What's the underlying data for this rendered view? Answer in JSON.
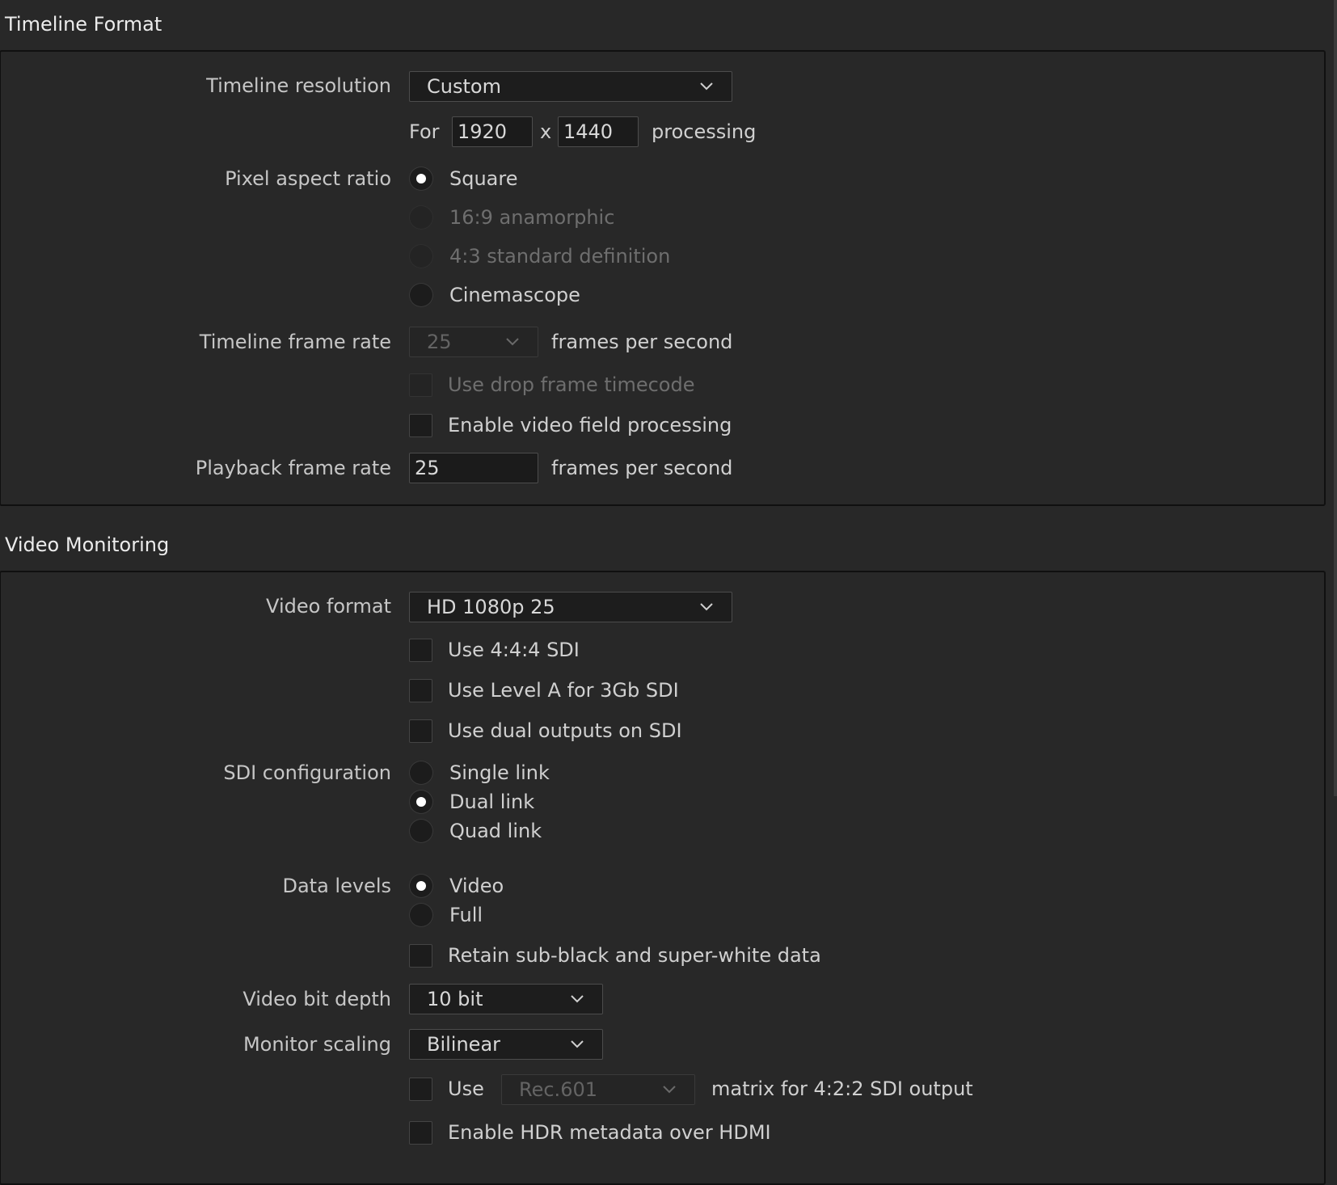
{
  "timeline_format": {
    "title": "Timeline Format",
    "timeline_resolution": {
      "label": "Timeline resolution",
      "value": "Custom"
    },
    "processing": {
      "for": "For",
      "width": "1920",
      "x": "x",
      "height": "1440",
      "suffix": "processing"
    },
    "pixel_aspect_ratio": {
      "label": "Pixel aspect ratio",
      "options": [
        {
          "label": "Square",
          "selected": true,
          "enabled": true
        },
        {
          "label": "16:9 anamorphic",
          "selected": false,
          "enabled": false
        },
        {
          "label": "4:3 standard definition",
          "selected": false,
          "enabled": false
        },
        {
          "label": "Cinemascope",
          "selected": false,
          "enabled": true
        }
      ]
    },
    "timeline_frame_rate": {
      "label": "Timeline frame rate",
      "value": "25",
      "suffix": "frames per second"
    },
    "use_drop_frame": {
      "label": "Use drop frame timecode",
      "checked": false,
      "enabled": false
    },
    "enable_field_processing": {
      "label": "Enable video field processing",
      "checked": false
    },
    "playback_frame_rate": {
      "label": "Playback frame rate",
      "value": "25",
      "suffix": "frames per second"
    }
  },
  "video_monitoring": {
    "title": "Video Monitoring",
    "video_format": {
      "label": "Video format",
      "value": "HD 1080p 25"
    },
    "use_444_sdi": {
      "label": "Use 4:4:4 SDI",
      "checked": false
    },
    "use_level_a": {
      "label": "Use Level A for 3Gb SDI",
      "checked": false
    },
    "use_dual_outputs": {
      "label": "Use dual outputs on SDI",
      "checked": false
    },
    "sdi_configuration": {
      "label": "SDI configuration",
      "options": [
        {
          "label": "Single link",
          "selected": false
        },
        {
          "label": "Dual link",
          "selected": true
        },
        {
          "label": "Quad link",
          "selected": false
        }
      ]
    },
    "data_levels": {
      "label": "Data levels",
      "options": [
        {
          "label": "Video",
          "selected": true
        },
        {
          "label": "Full",
          "selected": false
        }
      ]
    },
    "retain_sub_black": {
      "label": "Retain sub-black and super-white data",
      "checked": false
    },
    "video_bit_depth": {
      "label": "Video bit depth",
      "value": "10 bit"
    },
    "monitor_scaling": {
      "label": "Monitor scaling",
      "value": "Bilinear"
    },
    "use_matrix": {
      "use": "Use",
      "value": "Rec.601",
      "suffix": "matrix for 4:2:2 SDI output",
      "checked": false
    },
    "enable_hdr_metadata": {
      "label": "Enable HDR metadata over HDMI",
      "checked": false
    }
  },
  "colors": {
    "background": "#282828",
    "panel_border": "#101010",
    "text": "#d2d2d2",
    "dim_text": "#6e6e6e"
  },
  "icons": {
    "dropdown": "chevron-down-icon"
  }
}
